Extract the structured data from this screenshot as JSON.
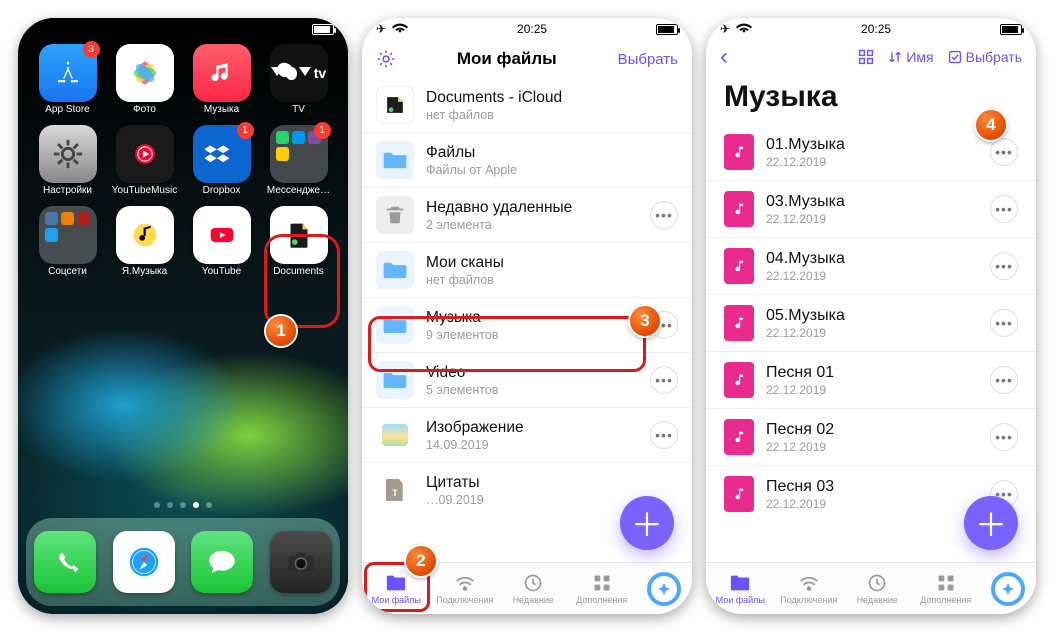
{
  "status": {
    "time": "20:25"
  },
  "screen1": {
    "apps": {
      "row1": [
        {
          "label": "App Store",
          "badge": "3",
          "kind": "appstore"
        },
        {
          "label": "Фото",
          "kind": "photos"
        },
        {
          "label": "Музыка",
          "kind": "music"
        },
        {
          "label": "TV",
          "kind": "tv"
        }
      ],
      "row2": [
        {
          "label": "Настройки",
          "kind": "settings"
        },
        {
          "label": "YouTubeMusic",
          "kind": "ytmusic"
        },
        {
          "label": "Dropbox",
          "kind": "dropbox",
          "badge": "1"
        },
        {
          "label": "Мессендже…",
          "kind": "folder-msgs",
          "badge": "1"
        }
      ],
      "row3": [
        {
          "label": "Соцсети",
          "kind": "folder-social"
        },
        {
          "label": "Я.Музыка",
          "kind": "yamusic"
        },
        {
          "label": "YouTube",
          "kind": "youtube"
        },
        {
          "label": "Documents",
          "kind": "docapp"
        }
      ]
    },
    "dock": [
      "phone",
      "safari",
      "messages",
      "camera"
    ]
  },
  "screen2": {
    "header": {
      "title": "Мои файлы",
      "select": "Выбрать"
    },
    "rows": [
      {
        "name": "Documents - iCloud",
        "sub": "нет файлов",
        "icon": "dcloud"
      },
      {
        "name": "Файлы",
        "sub": "Файлы от Apple",
        "icon": "folder"
      },
      {
        "name": "Недавно удаленные",
        "sub": "2 элемента",
        "icon": "trash",
        "more": true
      },
      {
        "name": "Мои сканы",
        "sub": "нет файлов",
        "icon": "folder"
      },
      {
        "name": "Музыка",
        "sub": "9 элементов",
        "icon": "folder",
        "more": true
      },
      {
        "name": "Video",
        "sub": "5 элементов",
        "icon": "folder",
        "more": true
      },
      {
        "name": "Изображение",
        "sub": "14.09.2019",
        "icon": "image",
        "more": true
      },
      {
        "name": "Цитаты",
        "sub": "…09.2019",
        "icon": "textfile",
        "more": true
      }
    ],
    "tabs": {
      "files": "Мои файлы",
      "conn": "Подключения",
      "recent": "Недавние",
      "addons": "Дополнения"
    }
  },
  "screen3": {
    "header": {
      "sort_label": "Имя",
      "select": "Выбрать"
    },
    "title": "Музыка",
    "rows": [
      {
        "name": "01.Музыка",
        "sub": "22.12.2019"
      },
      {
        "name": "03.Музыка",
        "sub": "22.12.2019"
      },
      {
        "name": "04.Музыка",
        "sub": "22.12.2019"
      },
      {
        "name": "05.Музыка",
        "sub": "22.12.2019"
      },
      {
        "name": "Песня 01",
        "sub": "22.12.2019"
      },
      {
        "name": "Песня 02",
        "sub": "22.12.2019"
      },
      {
        "name": "Песня 03",
        "sub": "22.12.2019"
      }
    ],
    "tabs": {
      "files": "Мои файлы",
      "conn": "Подключения",
      "recent": "Недавние",
      "addons": "Дополнения"
    }
  },
  "callouts": {
    "c1": "1",
    "c2": "2",
    "c3": "3",
    "c4": "4"
  }
}
